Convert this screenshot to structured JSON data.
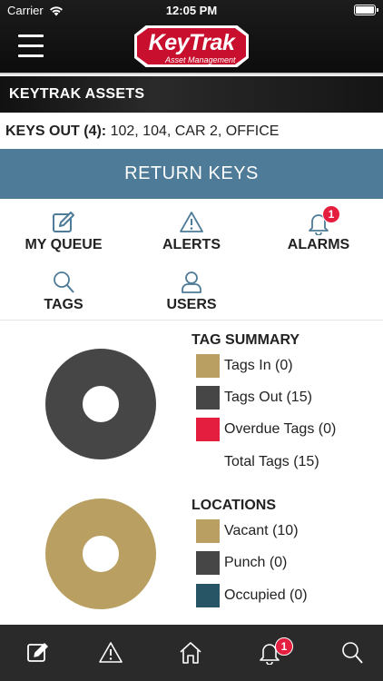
{
  "status_bar": {
    "carrier": "Carrier",
    "time": "12:05 PM"
  },
  "header": {
    "logo_text": "KeyTrak",
    "logo_subtext": "Asset Management",
    "menu_icon": "hamburger-menu-icon"
  },
  "section": {
    "title": "KEYTRAK ASSETS"
  },
  "keys_out": {
    "label": "KEYS OUT (4):",
    "value": "102, 104, CAR 2, OFFICE"
  },
  "return_button": {
    "label": "RETURN KEYS"
  },
  "quick_actions": [
    {
      "label": "MY QUEUE",
      "icon": "edit-icon",
      "badge": ""
    },
    {
      "label": "ALERTS",
      "icon": "warning-icon",
      "badge": ""
    },
    {
      "label": "ALARMS",
      "icon": "bell-icon",
      "badge": "1"
    },
    {
      "label": "TAGS",
      "icon": "search-icon",
      "badge": ""
    },
    {
      "label": "USERS",
      "icon": "user-icon",
      "badge": ""
    }
  ],
  "tag_summary": {
    "title": "TAG SUMMARY",
    "items": [
      {
        "label": "Tags In (0)",
        "color": "#b9a062",
        "value": 0
      },
      {
        "label": "Tags Out (15)",
        "color": "#464646",
        "value": 15
      },
      {
        "label": "Overdue Tags (0)",
        "color": "#e41e3f",
        "value": 0
      },
      {
        "label": "Total Tags (15)",
        "color": "",
        "value": 15
      }
    ]
  },
  "locations": {
    "title": "LOCATIONS",
    "items": [
      {
        "label": "Vacant (10)",
        "color": "#b9a062",
        "value": 10
      },
      {
        "label": "Punch (0)",
        "color": "#464646",
        "value": 0
      },
      {
        "label": "Occupied (0)",
        "color": "#275566",
        "value": 0
      }
    ]
  },
  "bottom_nav": {
    "items": [
      {
        "icon": "edit-icon",
        "badge": ""
      },
      {
        "icon": "warning-icon",
        "badge": ""
      },
      {
        "icon": "home-icon",
        "badge": ""
      },
      {
        "icon": "bell-icon",
        "badge": "1"
      },
      {
        "icon": "search-icon",
        "badge": ""
      }
    ]
  }
}
